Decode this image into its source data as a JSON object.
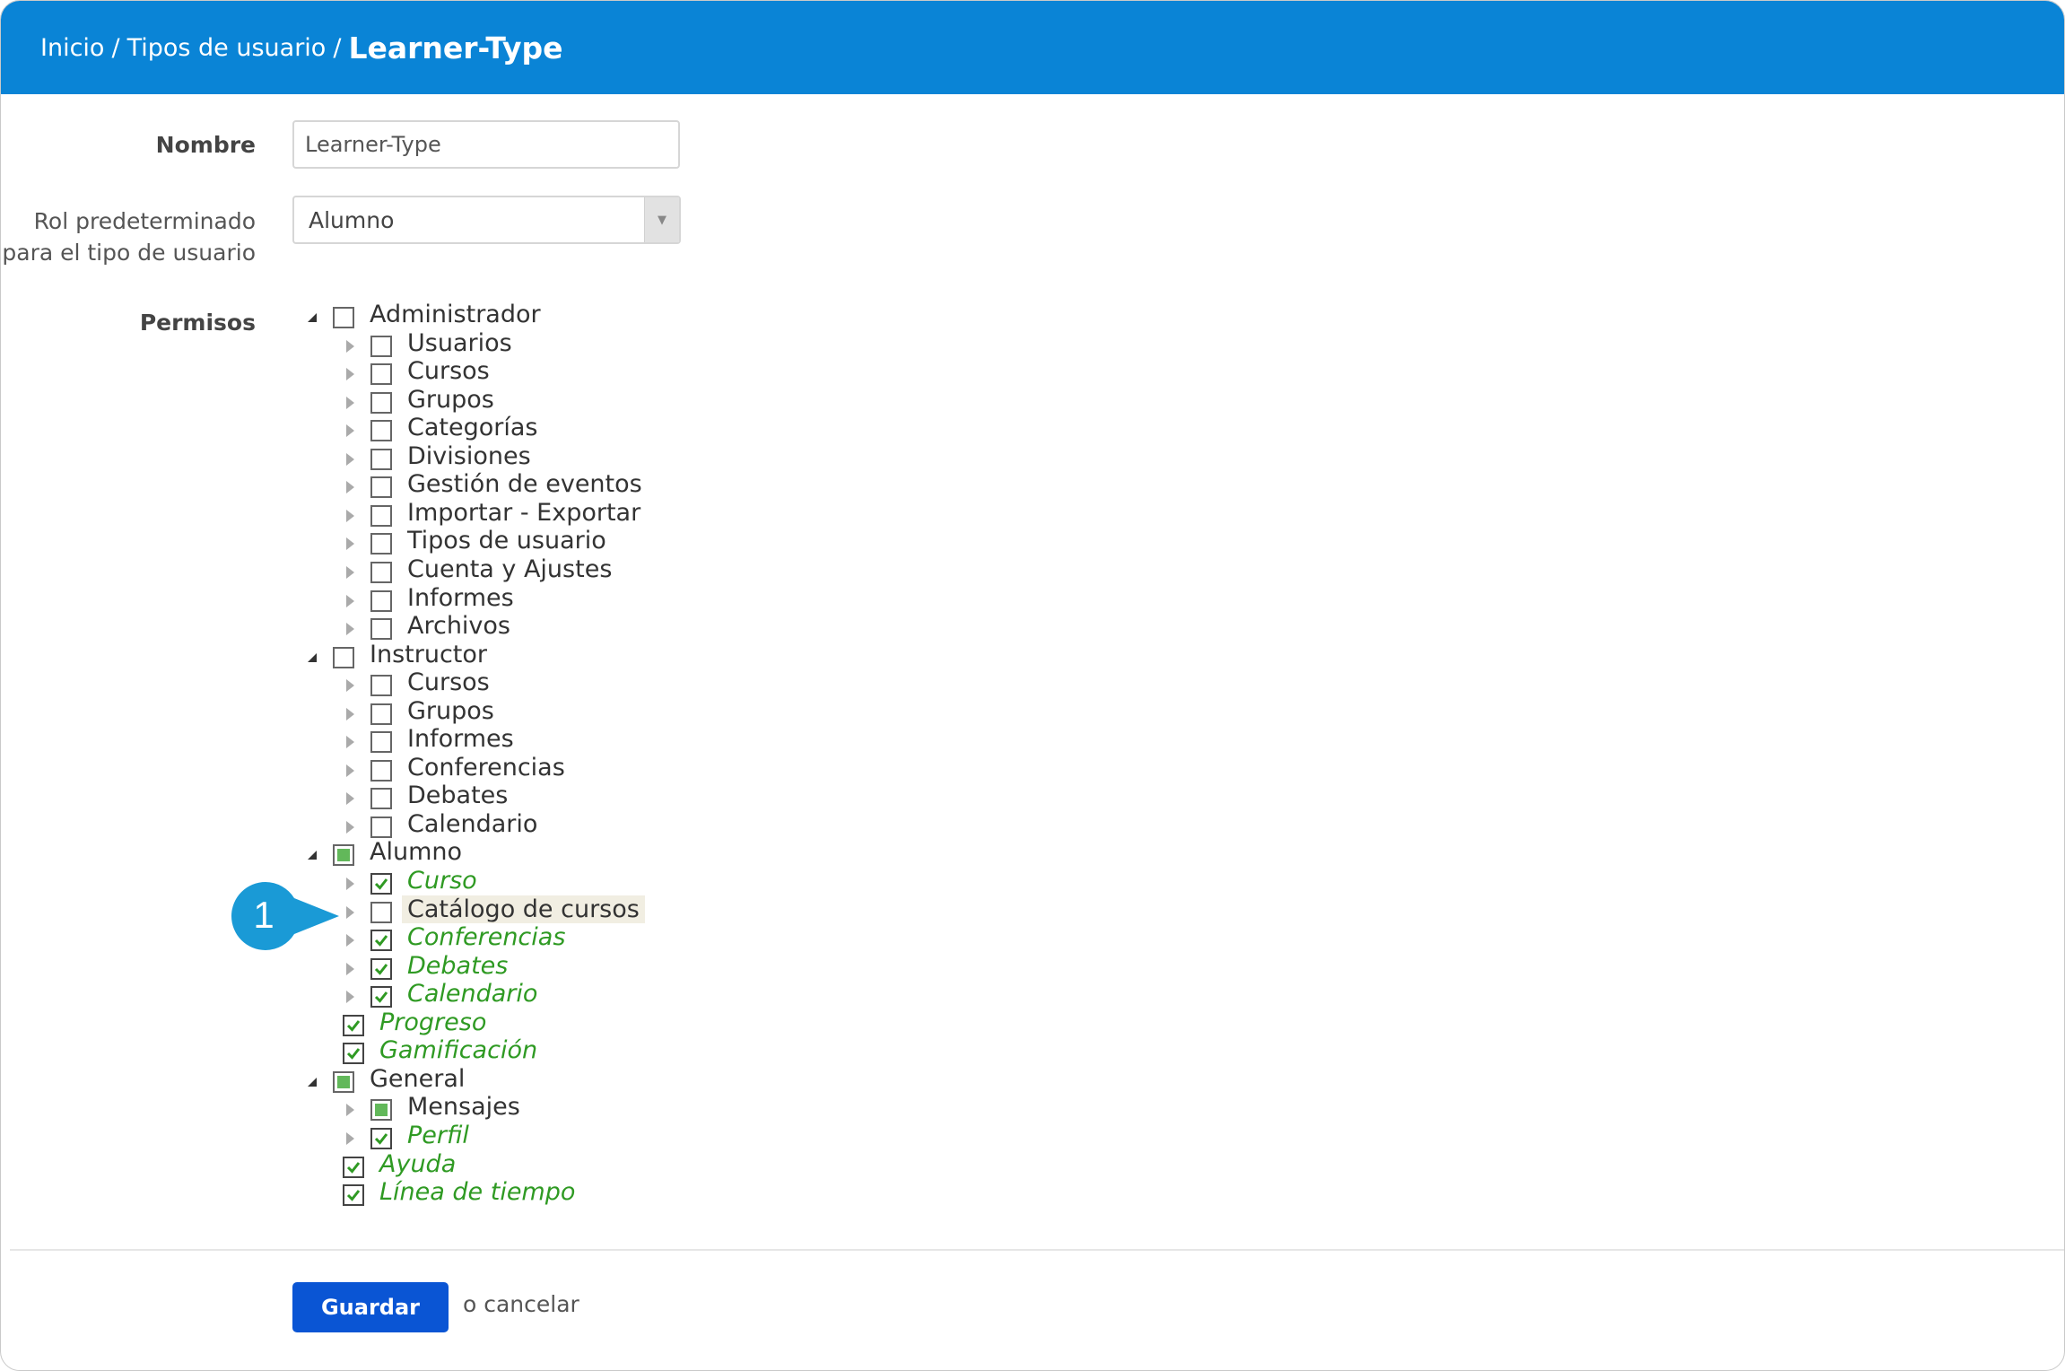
{
  "breadcrumb": {
    "home": "Inicio",
    "separator": "/",
    "section": "Tipos de usuario",
    "current": "Learner-Type"
  },
  "form": {
    "name_label": "Nombre",
    "name_value": "Learner-Type",
    "role_label_line1": "Rol predeterminado",
    "role_label_line2": "para el tipo de usuario",
    "role_value": "Alumno",
    "permissions_label": "Permisos"
  },
  "permissions": {
    "admin": {
      "label": "Administrador",
      "children": [
        "Usuarios",
        "Cursos",
        "Grupos",
        "Categorías",
        "Divisiones",
        "Gestión de eventos",
        "Importar - Exportar",
        "Tipos de usuario",
        "Cuenta y Ajustes",
        "Informes",
        "Archivos"
      ]
    },
    "instructor": {
      "label": "Instructor",
      "children": [
        "Cursos",
        "Grupos",
        "Informes",
        "Conferencias",
        "Debates",
        "Calendario"
      ]
    },
    "learner": {
      "label": "Alumno",
      "children": [
        "Curso",
        "Catálogo de cursos",
        "Conferencias",
        "Debates",
        "Calendario",
        "Progreso",
        "Gamificación"
      ]
    },
    "general": {
      "label": "General",
      "children": [
        "Mensajes",
        "Perfil",
        "Ayuda",
        "Línea de tiempo"
      ]
    }
  },
  "callout": {
    "number": "1",
    "color": "#1a9ad6"
  },
  "actions": {
    "save_label": "Guardar",
    "cancel_label": "o cancelar"
  },
  "colors": {
    "header_bg": "#0a84d6",
    "checked_text": "#2f9a23",
    "save_button": "#0a55d4"
  }
}
